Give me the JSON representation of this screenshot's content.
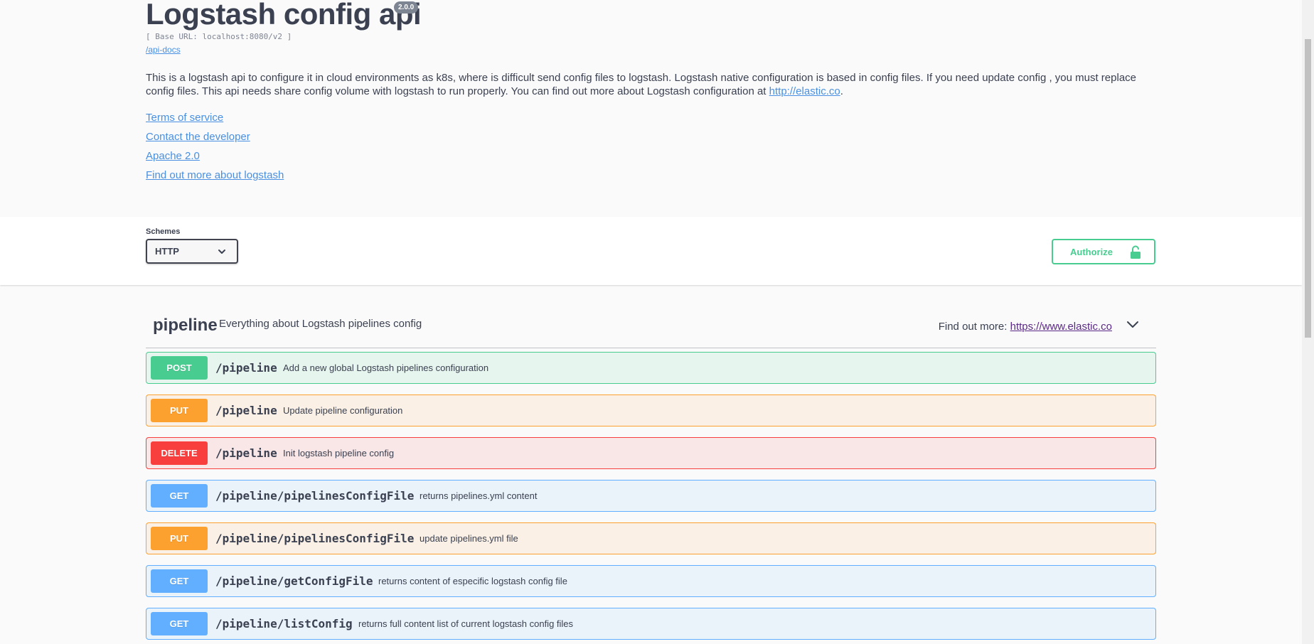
{
  "info": {
    "title": "Logstash config api",
    "version": "2.0.0",
    "base_url": "[ Base URL: localhost:8080/v2 ]",
    "api_docs_link": "/api-docs",
    "description_text": "This is a logstash api to configure it in cloud environments as k8s, where is difficult send config files to logstash. Logstash native configuration is based in config files. If you need update config , you must replace config files. This api needs share config volume with logstash to run properly. You can find out more about Logstash configuration at ",
    "description_link": "http://elastic.co",
    "description_end": ".",
    "links": {
      "terms": "Terms of service",
      "contact": "Contact the developer",
      "license": "Apache 2.0",
      "external_docs": "Find out more about logstash"
    }
  },
  "schemes": {
    "label": "Schemes",
    "selected": "HTTP",
    "authorize_label": "Authorize"
  },
  "tag": {
    "name": "pipeline",
    "description": "Everything about Logstash pipelines config",
    "find_more_label": "Find out more: ",
    "find_more_link": "https://www.elastic.co"
  },
  "operations": [
    {
      "method": "POST",
      "path": "/pipeline",
      "summary": "Add a new global Logstash pipelines configuration"
    },
    {
      "method": "PUT",
      "path": "/pipeline",
      "summary": "Update pipeline configuration"
    },
    {
      "method": "DELETE",
      "path": "/pipeline",
      "summary": "Init logstash pipeline config"
    },
    {
      "method": "GET",
      "path": "/pipeline/pipelinesConfigFile",
      "summary": "returns pipelines.yml content"
    },
    {
      "method": "PUT",
      "path": "/pipeline/pipelinesConfigFile",
      "summary": "update pipelines.yml file"
    },
    {
      "method": "GET",
      "path": "/pipeline/getConfigFile",
      "summary": "returns content of especific logstash config file"
    },
    {
      "method": "GET",
      "path": "/pipeline/listConfig",
      "summary": "returns full content list of current logstash config files"
    }
  ],
  "colors": {
    "post": "#49cc90",
    "put": "#fca130",
    "delete": "#f93e3e",
    "get": "#61affe",
    "link": "#4990e2"
  },
  "icons": {
    "scheme_dropdown": "chevron-down-icon",
    "authorize": "unlock-icon",
    "tag_toggle": "chevron-down-icon"
  }
}
